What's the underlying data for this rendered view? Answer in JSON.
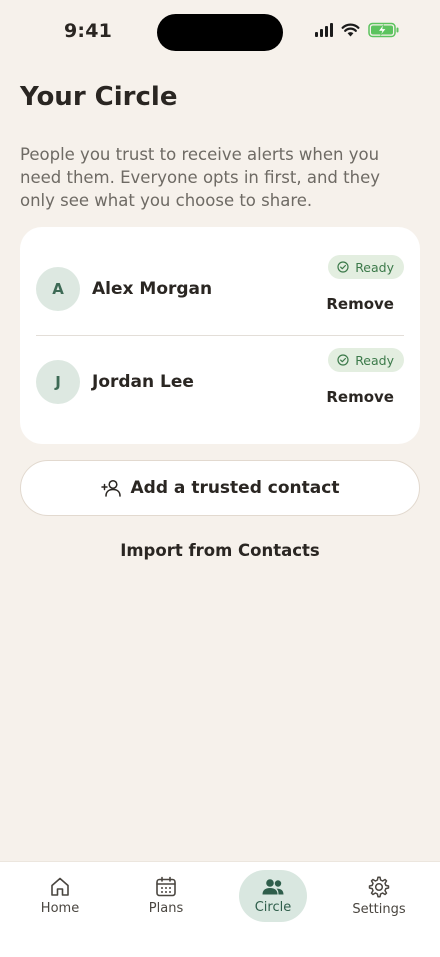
{
  "status_bar": {
    "time": "9:41"
  },
  "page": {
    "title": "Your Circle",
    "description": "People you trust to receive alerts when you need them. Everyone opts in first, and they only see what you choose to share."
  },
  "contacts": [
    {
      "initial": "A",
      "name": "Alex Morgan",
      "status": "Ready",
      "action": "Remove"
    },
    {
      "initial": "J",
      "name": "Jordan Lee",
      "status": "Ready",
      "action": "Remove"
    }
  ],
  "actions": {
    "add_contact": "Add a trusted contact",
    "import": "Import from Contacts"
  },
  "tabs": [
    {
      "label": "Home",
      "icon": "home-icon",
      "active": false
    },
    {
      "label": "Plans",
      "icon": "calendar-icon",
      "active": false
    },
    {
      "label": "Circle",
      "icon": "people-icon",
      "active": true
    },
    {
      "label": "Settings",
      "icon": "gear-icon",
      "active": false
    }
  ],
  "colors": {
    "background": "#f6f1eb",
    "accent": "#2f5e4b",
    "ready_badge_bg": "#e3eee0",
    "ready_badge_text": "#3c7a4a"
  }
}
